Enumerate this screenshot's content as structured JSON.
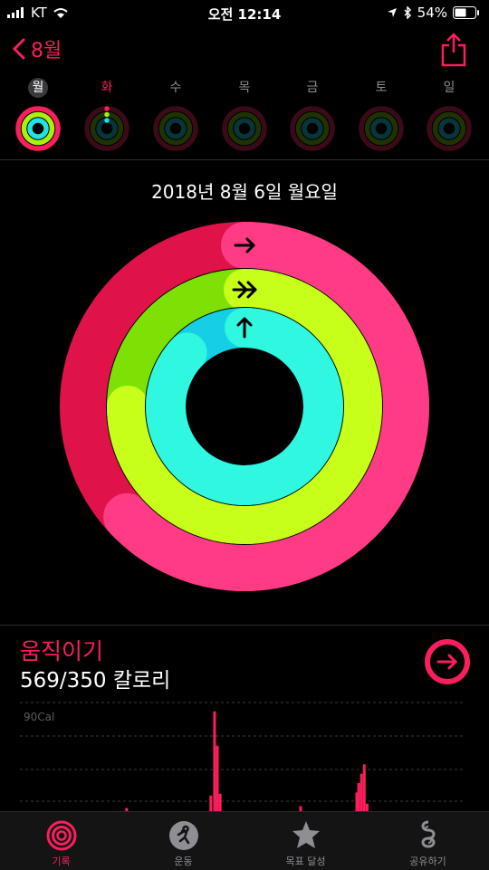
{
  "status": {
    "carrier": "KT",
    "time": "오전 12:14",
    "battery": "54%"
  },
  "nav": {
    "back_label": "8월"
  },
  "week": [
    {
      "label": "월",
      "state": "selected"
    },
    {
      "label": "화",
      "state": "today"
    },
    {
      "label": "수",
      "state": "normal"
    },
    {
      "label": "목",
      "state": "normal"
    },
    {
      "label": "금",
      "state": "normal"
    },
    {
      "label": "토",
      "state": "normal"
    },
    {
      "label": "일",
      "state": "normal"
    }
  ],
  "date_title": "2018년 8월 6일 월요일",
  "rings": {
    "move": 1.63,
    "exercise": 1.75,
    "stand": 0.87
  },
  "move": {
    "title": "움직이기",
    "value": "569/350 칼로리"
  },
  "chart": {
    "gridline_label": "90Cal"
  },
  "chart_data": {
    "type": "bar",
    "ylabel": "",
    "gridline_label": "90Cal",
    "bars": [
      {
        "hour": 5.7,
        "value": 5
      },
      {
        "hour": 10.2,
        "value": 25
      },
      {
        "hour": 10.4,
        "value": 160
      },
      {
        "hour": 10.55,
        "value": 105
      },
      {
        "hour": 10.7,
        "value": 28
      },
      {
        "hour": 15.0,
        "value": 8
      },
      {
        "hour": 18.0,
        "value": 30
      },
      {
        "hour": 18.1,
        "value": 45
      },
      {
        "hour": 18.25,
        "value": 60
      },
      {
        "hour": 18.4,
        "value": 75
      },
      {
        "hour": 18.55,
        "value": 12
      }
    ],
    "ylim": [
      0,
      180
    ]
  },
  "tabs": [
    {
      "label": "기록",
      "icon": "history-ring-icon",
      "active": true
    },
    {
      "label": "운동",
      "icon": "runner-icon",
      "active": false
    },
    {
      "label": "목표 달성",
      "icon": "star-badge-icon",
      "active": false
    },
    {
      "label": "공유하기",
      "icon": "share-ring-icon",
      "active": false
    }
  ],
  "colors": {
    "move": "#fa1f5c",
    "exercise": "#a8f10b",
    "stand": "#1ee4e4",
    "accent": "#fa1f5c"
  }
}
